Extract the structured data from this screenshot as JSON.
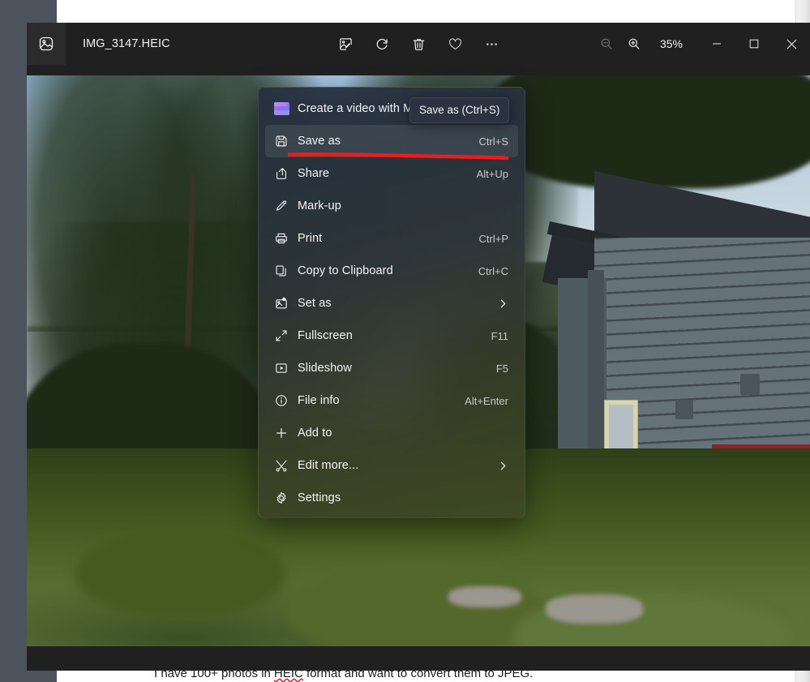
{
  "background_page": {
    "text_before": "I have 100+ photos in ",
    "misspelled_word": "HEIC",
    "text_after": " format and want to convert them to JPEG."
  },
  "window": {
    "title_bar": {
      "app_icon": "photos-app-icon",
      "file_name": "IMG_3147.HEIC",
      "tools": [
        {
          "name": "edit-image",
          "icon": "edit-image-icon",
          "label": "Edit image"
        },
        {
          "name": "rotate",
          "icon": "rotate-icon",
          "label": "Rotate"
        },
        {
          "name": "delete",
          "icon": "trash-icon",
          "label": "Delete"
        },
        {
          "name": "favorite",
          "icon": "heart-icon",
          "label": "Add to favorites"
        },
        {
          "name": "see-more",
          "icon": "ellipsis-icon",
          "label": "See more"
        }
      ],
      "zoom_out": {
        "icon": "zoom-out-icon",
        "label": "Zoom out",
        "disabled": true
      },
      "zoom_in": {
        "icon": "zoom-in-icon",
        "label": "Zoom in",
        "disabled": false
      },
      "zoom_level": "35%",
      "caption_buttons": [
        {
          "name": "minimize",
          "icon": "minimize-icon",
          "glyph": "–"
        },
        {
          "name": "maximize",
          "icon": "maximize-icon",
          "glyph": "☐"
        },
        {
          "name": "close",
          "icon": "close-icon",
          "glyph": "✕"
        }
      ]
    }
  },
  "context_menu": {
    "items": [
      {
        "label": "Create a video with Microsoft Clipchamp",
        "accel": "",
        "icon": "clipchamp-icon",
        "chevron": false,
        "highlighted": false,
        "truncated": true
      },
      {
        "label": "Save as",
        "accel": "Ctrl+S",
        "icon": "save-icon",
        "chevron": false,
        "highlighted": true
      },
      {
        "label": "Share",
        "accel": "Alt+Up",
        "icon": "share-icon",
        "chevron": false,
        "highlighted": false
      },
      {
        "label": "Mark-up",
        "accel": "",
        "icon": "pen-icon",
        "chevron": false,
        "highlighted": false
      },
      {
        "label": "Print",
        "accel": "Ctrl+P",
        "icon": "printer-icon",
        "chevron": false,
        "highlighted": false
      },
      {
        "label": "Copy to Clipboard",
        "accel": "Ctrl+C",
        "icon": "copy-icon",
        "chevron": false,
        "highlighted": false
      },
      {
        "label": "Set as",
        "accel": "",
        "icon": "set-as-image-icon",
        "chevron": true,
        "highlighted": false
      },
      {
        "label": "Fullscreen",
        "accel": "F11",
        "icon": "fullscreen-icon",
        "chevron": false,
        "highlighted": false
      },
      {
        "label": "Slideshow",
        "accel": "F5",
        "icon": "slideshow-icon",
        "chevron": false,
        "highlighted": false
      },
      {
        "label": "File info",
        "accel": "Alt+Enter",
        "icon": "info-icon",
        "chevron": false,
        "highlighted": false
      },
      {
        "label": "Add to",
        "accel": "",
        "icon": "plus-icon",
        "chevron": false,
        "highlighted": false
      },
      {
        "label": "Edit more...",
        "accel": "",
        "icon": "edit-more-icon",
        "chevron": true,
        "highlighted": false
      },
      {
        "label": "Settings",
        "accel": "",
        "icon": "gear-icon",
        "chevron": false,
        "highlighted": false
      }
    ]
  },
  "tooltip": {
    "text": "Save as (Ctrl+S)"
  },
  "annotation": {
    "color": "#f01b1b",
    "shape": "red-underline-stroke"
  },
  "colors": {
    "desktop_background": "#4c535c",
    "window_chrome": "#202020",
    "menu_highlight": "rgba(255,255,255,.085)",
    "annotation_red": "#f01b1b"
  }
}
